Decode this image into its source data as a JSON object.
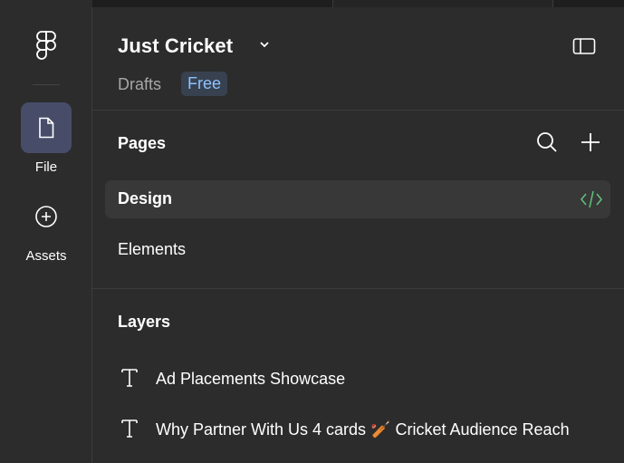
{
  "rail": {
    "items": [
      {
        "label": "File"
      },
      {
        "label": "Assets"
      }
    ]
  },
  "header": {
    "title": "Just Cricket",
    "location": "Drafts",
    "plan_badge": "Free"
  },
  "pages": {
    "heading": "Pages",
    "items": [
      {
        "label": "Design",
        "selected": true
      },
      {
        "label": "Elements",
        "selected": false
      }
    ]
  },
  "layers": {
    "heading": "Layers",
    "items": [
      {
        "label": "Ad Placements Showcase"
      },
      {
        "label": "Why Partner With Us 4 cards 🏏 Cricket Audience Reach"
      }
    ]
  },
  "colors": {
    "background": "#2c2c2c",
    "active_rail": "#474d69",
    "badge_bg": "#37414f",
    "badge_text": "#8ec2ff",
    "dev_mode_green": "#5fbd7a"
  }
}
